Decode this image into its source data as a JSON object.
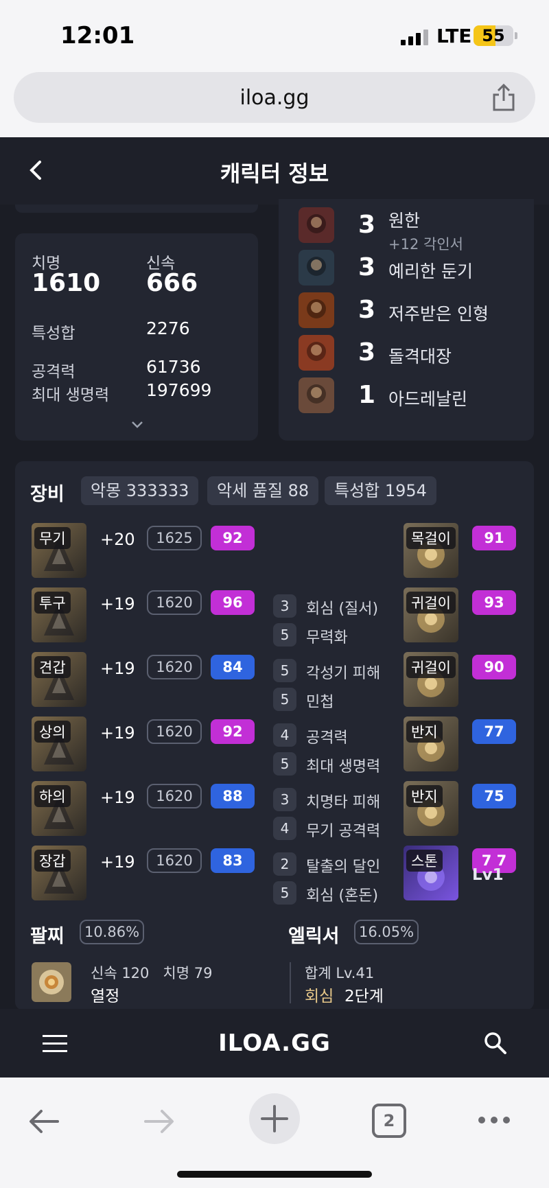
{
  "status_bar": {
    "time": "12:01",
    "network": "LTE",
    "battery": "55",
    "battery_level": 0.55
  },
  "browser": {
    "url": "iloa.gg",
    "tab_count": "2"
  },
  "header": {
    "title": "캐릭터 정보"
  },
  "stats": {
    "crit_label": "치명",
    "crit_value": "1610",
    "swift_label": "신속",
    "swift_value": "666",
    "total_label": "특성합",
    "total_value": "2276",
    "attack_label": "공격력",
    "attack_value": "61736",
    "hp_label": "최대 생명력",
    "hp_value": "197699"
  },
  "engravings": [
    {
      "level": "3",
      "name": "원한",
      "sub": "+12 각인서",
      "icon": "grudge-icon",
      "color": "#5a2a2a"
    },
    {
      "level": "3",
      "name": "예리한 둔기",
      "sub": "",
      "icon": "blunt-icon",
      "color": "#2b3a48"
    },
    {
      "level": "3",
      "name": "저주받은 인형",
      "sub": "",
      "icon": "doll-icon",
      "color": "#7a3a1a"
    },
    {
      "level": "3",
      "name": "돌격대장",
      "sub": "",
      "icon": "raid-captain-icon",
      "color": "#8a3a22"
    },
    {
      "level": "1",
      "name": "아드레날린",
      "sub": "",
      "icon": "adrenaline-icon",
      "color": "#6a4a3a"
    }
  ],
  "equipment": {
    "title": "장비",
    "pills": [
      "악몽 333333",
      "악세 품질 88",
      "특성합 1954"
    ],
    "gear": [
      {
        "slot": "무기",
        "enhance": "+20",
        "ilvl": "1625",
        "quality": "92",
        "tier": "purple"
      },
      {
        "slot": "투구",
        "enhance": "+19",
        "ilvl": "1620",
        "quality": "96",
        "tier": "purple"
      },
      {
        "slot": "견갑",
        "enhance": "+19",
        "ilvl": "1620",
        "quality": "84",
        "tier": "blue"
      },
      {
        "slot": "상의",
        "enhance": "+19",
        "ilvl": "1620",
        "quality": "92",
        "tier": "purple"
      },
      {
        "slot": "하의",
        "enhance": "+19",
        "ilvl": "1620",
        "quality": "88",
        "tier": "blue"
      },
      {
        "slot": "장갑",
        "enhance": "+19",
        "ilvl": "1620",
        "quality": "83",
        "tier": "blue"
      }
    ],
    "accessory_effects": [
      {
        "n": "3",
        "t": "회심 (질서)"
      },
      {
        "n": "5",
        "t": "무력화"
      },
      {
        "n": "5",
        "t": "각성기 피해"
      },
      {
        "n": "5",
        "t": "민첩"
      },
      {
        "n": "4",
        "t": "공격력"
      },
      {
        "n": "5",
        "t": "최대 생명력"
      },
      {
        "n": "3",
        "t": "치명타 피해"
      },
      {
        "n": "4",
        "t": "무기 공격력"
      },
      {
        "n": "2",
        "t": "탈출의 달인"
      },
      {
        "n": "5",
        "t": "회심 (혼돈)"
      }
    ],
    "accessories": [
      {
        "slot": "목걸이",
        "quality": "91",
        "tier": "purple"
      },
      {
        "slot": "귀걸이",
        "quality": "93",
        "tier": "purple"
      },
      {
        "slot": "귀걸이",
        "quality": "90",
        "tier": "purple"
      },
      {
        "slot": "반지",
        "quality": "77",
        "tier": "blue"
      },
      {
        "slot": "반지",
        "quality": "75",
        "tier": "blue"
      },
      {
        "slot": "스톤",
        "quality": "7 7",
        "tier": "purple"
      }
    ],
    "stone_level": "Lv1"
  },
  "bracelet": {
    "title": "팔찌",
    "percent": "10.86%",
    "stats": "신속 120   치명 79",
    "effect": "열정"
  },
  "elixir": {
    "title": "엘릭서",
    "percent": "16.05%",
    "total": "합계 Lv.41",
    "effect_name": "회심",
    "effect_level": "2단계",
    "accent": "#e6c789"
  },
  "app_bar": {
    "logo": "ILOA.GG"
  }
}
